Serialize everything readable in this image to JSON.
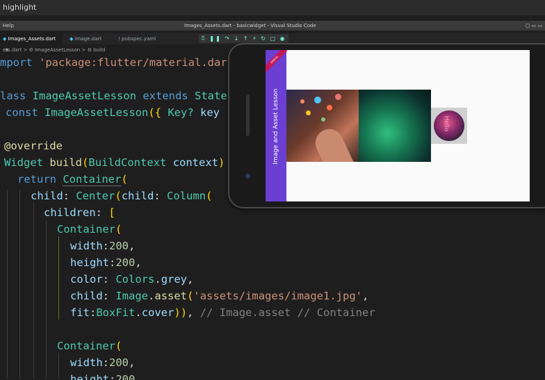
{
  "top_band": {
    "text": "highlight"
  },
  "titlebar": {
    "menu": "Help",
    "window_title": "Images_Assets.dart - basicwidget - Visual Studio Code",
    "icons": "▢ ▭ ▭"
  },
  "tabs": [
    {
      "label": "Images_Assets.dart",
      "close": "×"
    },
    {
      "label": "image.dart"
    },
    {
      "label": "pubspec.yaml"
    }
  ],
  "debug_toolbar": {
    "icons": "⠿ ❚❚ ↷ ↓ ↑ ⚡ ↻ □ ◉"
  },
  "breadcrumb": "ets.dart > ⚙ ImageAssetLesson > ⚙ build",
  "code": {
    "l1_kw": "mport",
    "l1_str": "'package:flutter/material.dar",
    "l2_kw": "lass",
    "l2_cls": "ImageAssetLesson",
    "l2_kw2": "extends",
    "l2_cls2": "State",
    "l3_kw": "const",
    "l3_cls": "ImageAssetLesson",
    "l3_paren": "({",
    "l3_cls2": "Key?",
    "l3_prop": "key",
    "l4": "@override",
    "l5_cls": "Widget",
    "l5_fn": "build",
    "l5_paren": "(",
    "l5_cls2": "BuildContext",
    "l5_prop": "context",
    "l5_paren2": ")",
    "l6_kw": "return",
    "l6_cls": "Container",
    "l6_paren": "(",
    "l7_prop": "child",
    "l7_cls": "Center",
    "l7_prop2": "child",
    "l7_cls2": "Column",
    "l8_prop": "children",
    "l8_br": "[",
    "l9_cls": "Container",
    "l10_prop": "width",
    "l10_num": "200",
    "l11_prop": "height",
    "l11_num": "200",
    "l12_prop": "color",
    "l12_cls": "Colors",
    "l12_prop2": "grey",
    "l13_prop": "child",
    "l13_cls": "Image",
    "l13_fn": "asset",
    "l13_str": "'assets/images/image1.jpg'",
    "l14_prop": "fit",
    "l14_cls": "BoxFit",
    "l14_prop2": "cover",
    "l14_cmt": "// Image.asset // Container",
    "l15_cls": "Container",
    "l16_prop": "width",
    "l16_num": "200",
    "l17_prop": "height",
    "l17_num": "200"
  },
  "emulator": {
    "appbar_title": "Image and Asset Lesson",
    "debug_banner": "DEBUG",
    "overlay_text": "Hello",
    "cursor": "↖"
  }
}
